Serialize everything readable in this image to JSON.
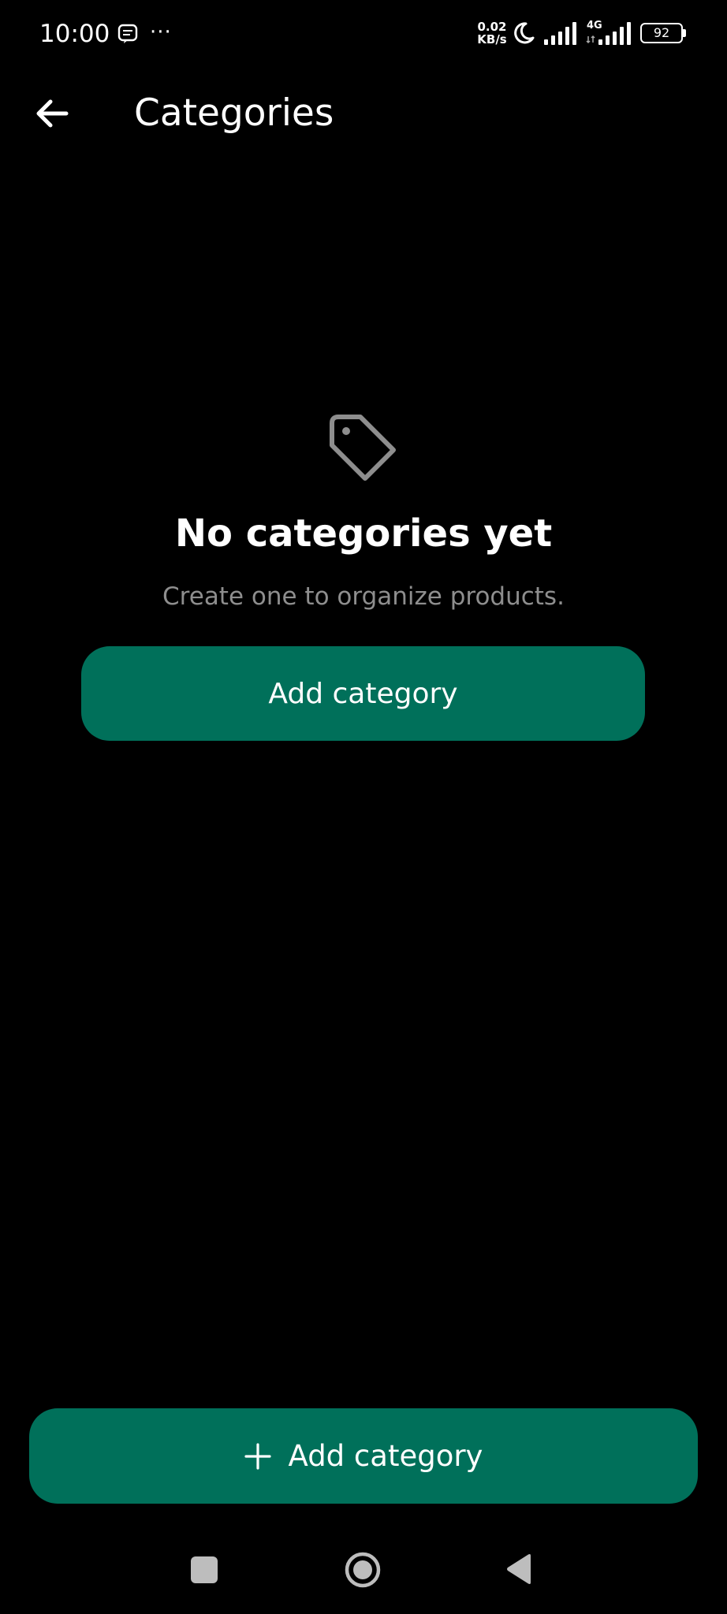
{
  "status_bar": {
    "time": "10:00",
    "more": "···",
    "speed_value": "0.02",
    "speed_unit": "KB/s",
    "network": "4G",
    "battery": "92"
  },
  "app_bar": {
    "title": "Categories",
    "back_icon": "arrow-left-icon"
  },
  "empty_state": {
    "icon": "tag-icon",
    "title": "No categories yet",
    "subtitle": "Create one to organize products.",
    "button_label": "Add category"
  },
  "bottom_action": {
    "icon": "plus-icon",
    "label": "Add category"
  },
  "colors": {
    "background": "#000000",
    "accent": "#00705a",
    "text_primary": "#ffffff",
    "text_secondary": "#8e8e8e"
  }
}
